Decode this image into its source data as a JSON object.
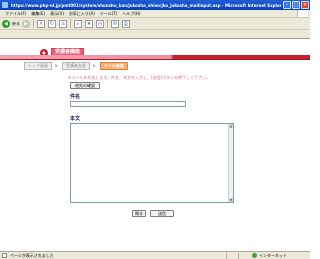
{
  "window": {
    "title": "https://www.php-nl.jp/pmt001/system/shonshu_kan/jukosha_shien/jko_jukosha_mailinput.asp - Microsoft Internet Explorer"
  },
  "menu": {
    "items": [
      "ファイル(F)",
      "編集(E)",
      "表示(V)",
      "お気に入り(A)",
      "ツール(T)",
      "ヘルプ(H)"
    ]
  },
  "toolbar": {
    "back_label": "戻る"
  },
  "header": {
    "title": "受講者機能"
  },
  "breadcrumb": {
    "items": [
      "トップ画面",
      "受講者支援",
      "メール送信"
    ]
  },
  "notice": "※メールを作成します。件名、本文を入力し、[送信]ボタンを押下して下さい。",
  "form": {
    "recipient_button": "宛先の確認",
    "subject_label": "件名",
    "subject_value": "",
    "body_label": "本文",
    "body_value": "",
    "close_button": "閉る",
    "send_button": "送信"
  },
  "status": {
    "text": "ページが表示されました",
    "zone": "インターネット"
  }
}
